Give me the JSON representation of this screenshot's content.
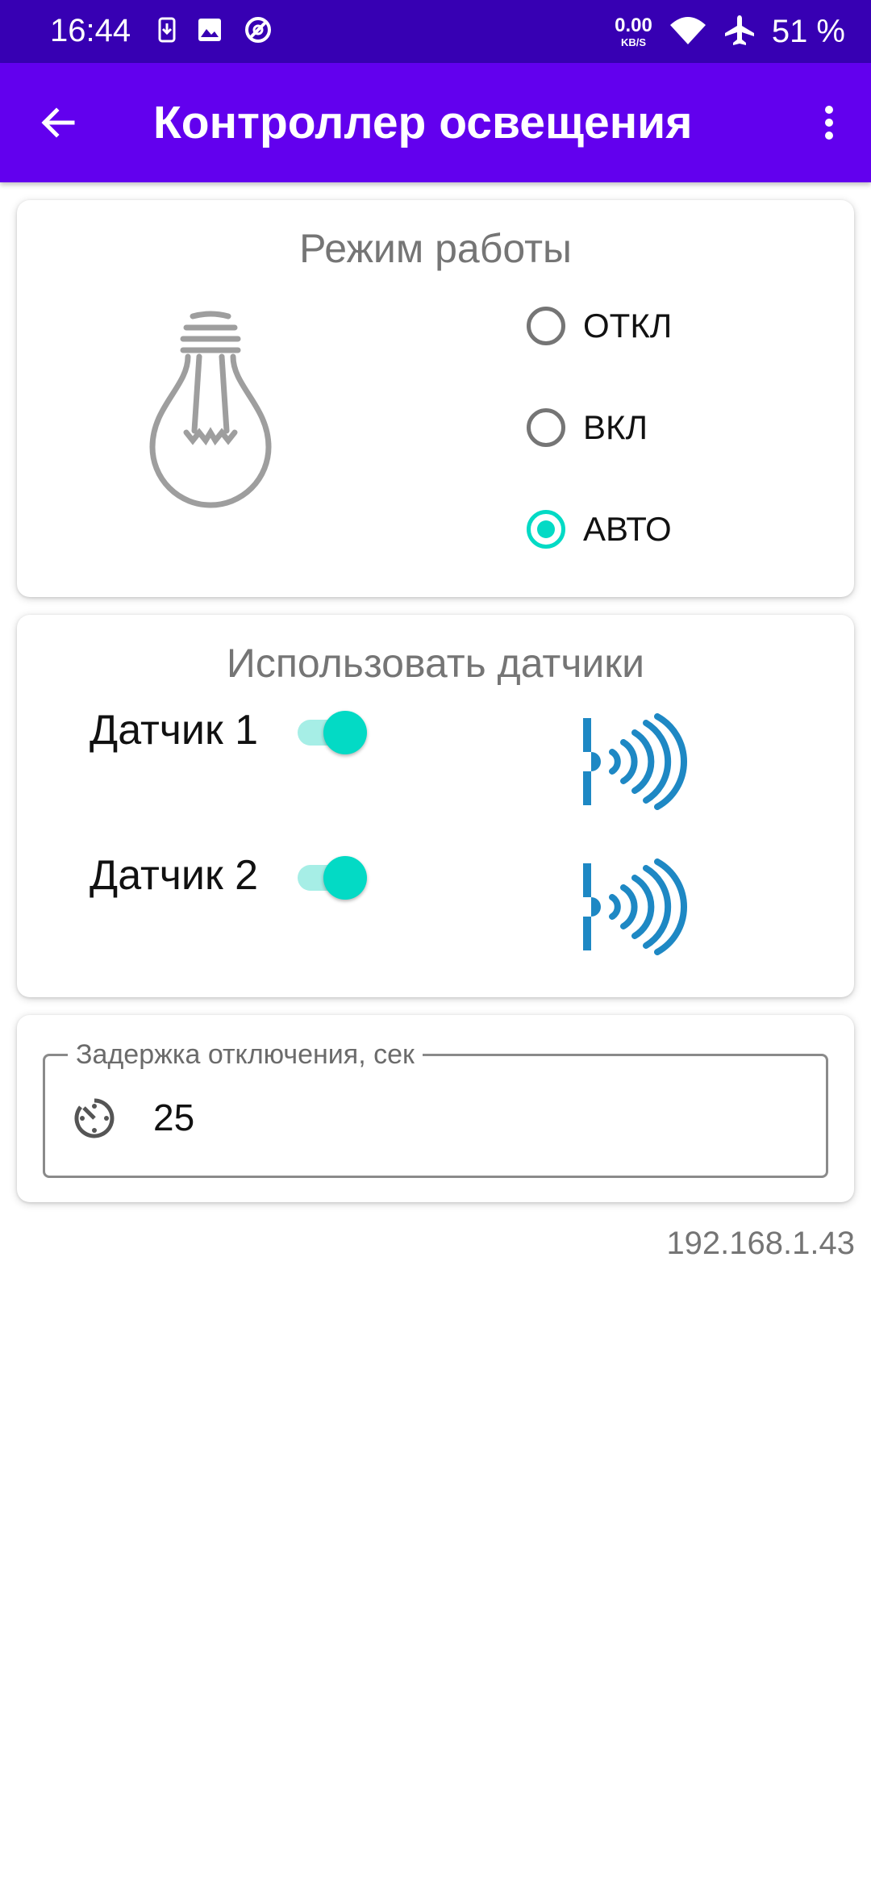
{
  "status_bar": {
    "time": "16:44",
    "net_speed_value": "0.00",
    "net_speed_unit": "KB/S",
    "battery": "51 %",
    "icons": [
      "download-icon",
      "image-icon",
      "data-saver-icon",
      "wifi-icon",
      "airplane-icon"
    ]
  },
  "app_bar": {
    "title": "Контроллер освещения",
    "back_icon": "arrow-back-icon",
    "menu_icon": "more-vert-icon"
  },
  "mode_card": {
    "title": "Режим работы",
    "options": [
      {
        "label": "ОТКЛ",
        "selected": false
      },
      {
        "label": "ВКЛ",
        "selected": false
      },
      {
        "label": "АВТО",
        "selected": true
      }
    ]
  },
  "sensors_card": {
    "title": "Использовать датчики",
    "sensors": [
      {
        "label": "Датчик 1",
        "enabled": true
      },
      {
        "label": "Датчик 2",
        "enabled": true
      }
    ]
  },
  "delay_card": {
    "label": "Задержка отключения, сек",
    "value": "25"
  },
  "ip_address": "192.168.1.43",
  "colors": {
    "status_bar": "#3700b3",
    "app_bar": "#6200ee",
    "accent": "#03dac5",
    "sensor_icon": "#1e88c4",
    "bulb": "#9e9e9e"
  }
}
